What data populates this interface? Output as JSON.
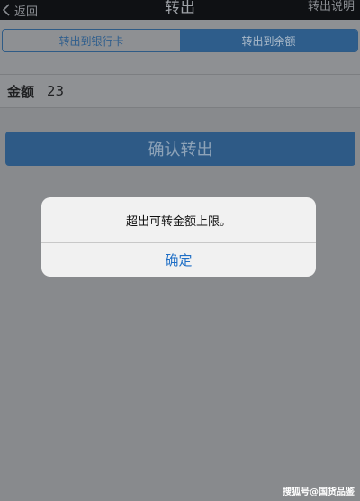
{
  "navbar": {
    "back_label": "返回",
    "title": "转出",
    "help_label": "转出说明"
  },
  "segments": [
    {
      "label": "转出到银行卡",
      "active": false
    },
    {
      "label": "转出到余额",
      "active": true
    }
  ],
  "amount": {
    "label": "金额",
    "value": "23"
  },
  "confirm_button": {
    "label": "确认转出"
  },
  "alert": {
    "message": "超出可转金额上限。",
    "button_label": "确定"
  },
  "watermark": {
    "text": "搜狐号@国货品鉴"
  },
  "colors": {
    "accent": "#2e5d8b",
    "alert_button": "#1f6fc6",
    "overlay_dim": "#888a8d"
  }
}
